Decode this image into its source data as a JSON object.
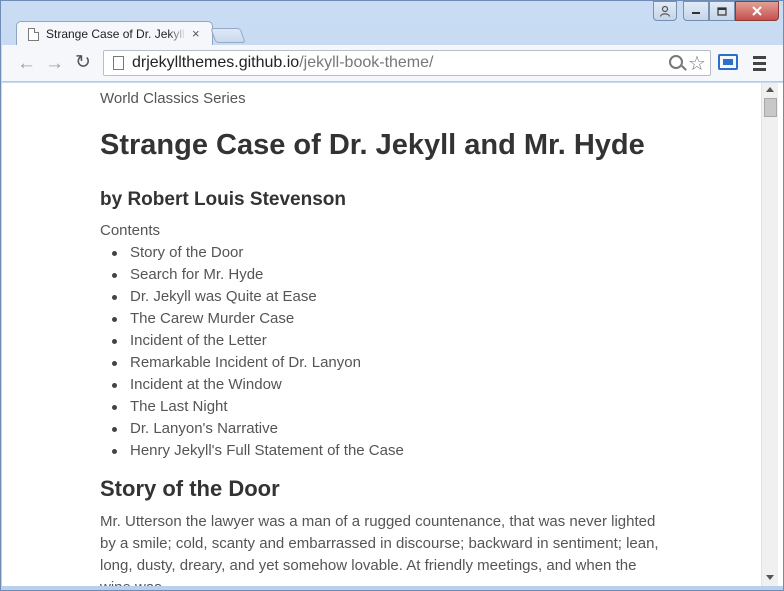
{
  "browser": {
    "tab_title": "Strange Case of Dr. Jekyll and Mr. Hyde",
    "tab_close": "×",
    "url_host": "drjekyllthemes.github.io",
    "url_path": "/jekyll-book-theme/",
    "accent_color": "#2a6fc9"
  },
  "page": {
    "series": "World Classics Series",
    "title": "Strange Case of Dr. Jekyll and Mr. Hyde",
    "author": "by Robert Louis Stevenson",
    "contents_label": "Contents",
    "toc": [
      "Story of the Door",
      "Search for Mr. Hyde",
      "Dr. Jekyll was Quite at Ease",
      "The Carew Murder Case",
      "Incident of the Letter",
      "Remarkable Incident of Dr. Lanyon",
      "Incident at the Window",
      "The Last Night",
      "Dr. Lanyon's Narrative",
      "Henry Jekyll's Full Statement of the Case"
    ],
    "chapter_title": "Story of the Door",
    "chapter_text": "Mr. Utterson the lawyer was a man of a rugged countenance, that was never lighted by a smile; cold, scanty and embarrassed in discourse; backward in sentiment; lean, long, dusty, dreary, and yet somehow lovable. At friendly meetings, and when the wine was"
  }
}
